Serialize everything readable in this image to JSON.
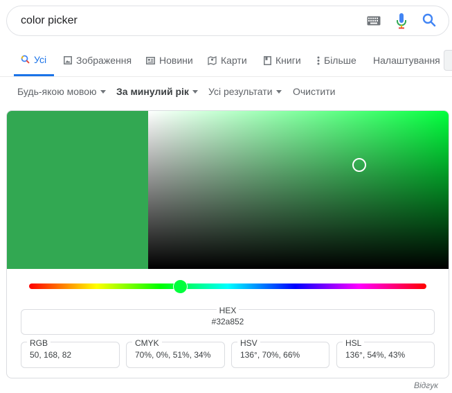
{
  "search": {
    "query": "color picker"
  },
  "tabs": [
    {
      "label": "Усі",
      "icon": "search-icon",
      "active": true
    },
    {
      "label": "Зображення",
      "icon": "image-icon"
    },
    {
      "label": "Новини",
      "icon": "news-icon"
    },
    {
      "label": "Карти",
      "icon": "map-icon"
    },
    {
      "label": "Книги",
      "icon": "book-icon"
    },
    {
      "label": "Більше",
      "icon": "more-vert-icon"
    },
    {
      "label": "Налаштування"
    }
  ],
  "filters": [
    {
      "label": "Будь-якою мовою"
    },
    {
      "label": "За минулий рік"
    },
    {
      "label": "Усі результати"
    },
    {
      "label": "Очистити"
    }
  ],
  "picker": {
    "selected_color": "#32a852",
    "hue_color": "#00ff3c",
    "hue_fraction": 0.38,
    "saturation": 0.7,
    "value": 0.66,
    "hex": {
      "label": "HEX",
      "value": "#32a852"
    },
    "rgb": {
      "label": "RGB",
      "value": "50, 168, 82"
    },
    "cmyk": {
      "label": "CMYK",
      "value": "70%, 0%, 51%, 34%"
    },
    "hsv": {
      "label": "HSV",
      "value": "136°, 70%, 66%"
    },
    "hsl": {
      "label": "HSL",
      "value": "136°, 54%, 43%"
    }
  },
  "feedback": "Відгук",
  "colors": {
    "accent": "#1a73e8",
    "muted": "#5f6368",
    "border": "#dadce0"
  }
}
